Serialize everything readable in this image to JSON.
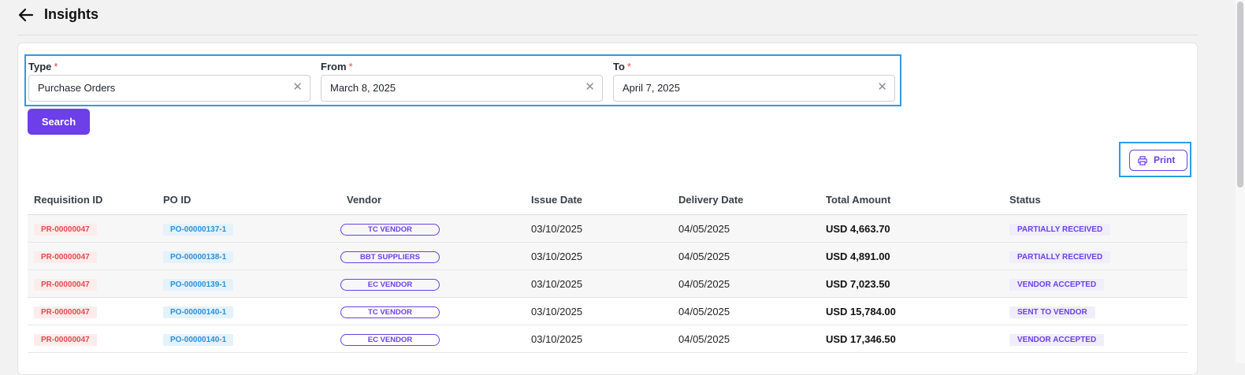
{
  "header": {
    "title": "Insights"
  },
  "filters": {
    "type": {
      "label": "Type",
      "value": "Purchase Orders"
    },
    "from": {
      "label": "From",
      "value": "March 8, 2025"
    },
    "to": {
      "label": "To",
      "value": "April 7, 2025"
    },
    "required_mark": "*",
    "clear_glyph": "✕"
  },
  "search_label": "Search",
  "print_label": "Print",
  "table": {
    "headers": [
      "Requisition ID",
      "PO ID",
      "Vendor",
      "Issue Date",
      "Delivery Date",
      "Total Amount",
      "Status"
    ],
    "rows": [
      {
        "req": "PR-00000047",
        "po": "PO-00000137-1",
        "vendor": "TC VENDOR",
        "issue": "03/10/2025",
        "delivery": "04/05/2025",
        "amount": "USD 4,663.70",
        "status": "PARTIALLY RECEIVED"
      },
      {
        "req": "PR-00000047",
        "po": "PO-00000138-1",
        "vendor": "BBT SUPPLIERS",
        "issue": "03/10/2025",
        "delivery": "04/05/2025",
        "amount": "USD 4,891.00",
        "status": "PARTIALLY RECEIVED"
      },
      {
        "req": "PR-00000047",
        "po": "PO-00000139-1",
        "vendor": "EC VENDOR",
        "issue": "03/10/2025",
        "delivery": "04/05/2025",
        "amount": "USD 7,023.50",
        "status": "VENDOR ACCEPTED"
      },
      {
        "req": "PR-00000047",
        "po": "PO-00000140-1",
        "vendor": "TC VENDOR",
        "issue": "03/10/2025",
        "delivery": "04/05/2025",
        "amount": "USD 15,784.00",
        "status": "SENT TO VENDOR"
      },
      {
        "req": "PR-00000047",
        "po": "PO-00000140-1",
        "vendor": "EC VENDOR",
        "issue": "03/10/2025",
        "delivery": "04/05/2025",
        "amount": "USD 17,346.50",
        "status": "VENDOR ACCEPTED"
      }
    ]
  },
  "icons": {
    "back": "arrow-left-icon",
    "print": "printer-icon",
    "clear": "close-icon"
  },
  "colors": {
    "accent": "#6c3fe8",
    "highlight": "#2b9be8",
    "pr": "#e5484d",
    "po": "#2f8fd8"
  }
}
